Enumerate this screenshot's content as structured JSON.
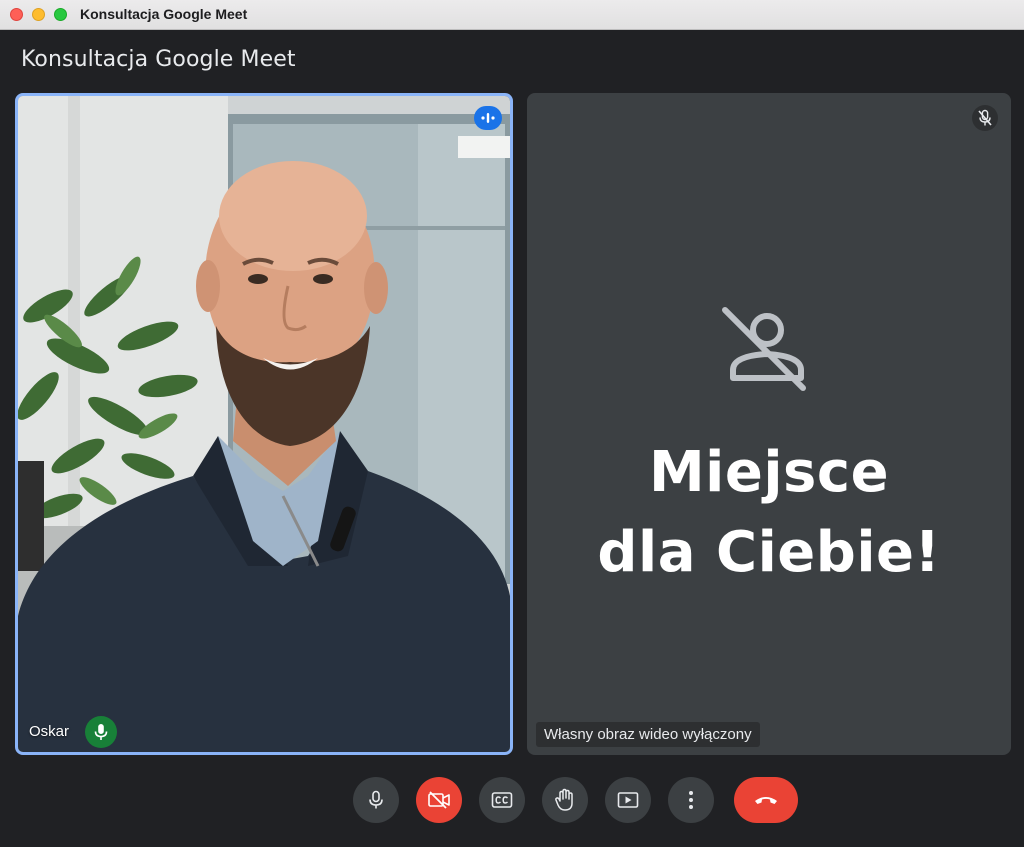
{
  "window": {
    "title": "Konsultacja Google Meet"
  },
  "meeting": {
    "title": "Konsultacja Google Meet"
  },
  "participants": [
    {
      "name": "Oskar",
      "mic": "on",
      "speaking": true,
      "video": "on"
    },
    {
      "placeholder_text_line1": "Miejsce",
      "placeholder_text_line2": "dla Ciebie!",
      "video_off_label": "Własny obraz wideo wyłączony",
      "mic": "muted",
      "video": "off"
    }
  ],
  "controls": [
    {
      "name": "microphone",
      "icon": "mic-icon"
    },
    {
      "name": "camera",
      "icon": "video-off-icon",
      "state": "off"
    },
    {
      "name": "captions",
      "icon": "cc-icon"
    },
    {
      "name": "raise-hand",
      "icon": "hand-icon"
    },
    {
      "name": "present",
      "icon": "present-icon"
    },
    {
      "name": "more-options",
      "icon": "more-vert-icon"
    },
    {
      "name": "end-call",
      "icon": "phone-hangup-icon"
    }
  ],
  "colors": {
    "background": "#202124",
    "tile": "#3c4043",
    "active_border": "#8ab4f8",
    "danger": "#ea4335",
    "mic_on": "#188038",
    "speaking": "#1a73e8"
  }
}
